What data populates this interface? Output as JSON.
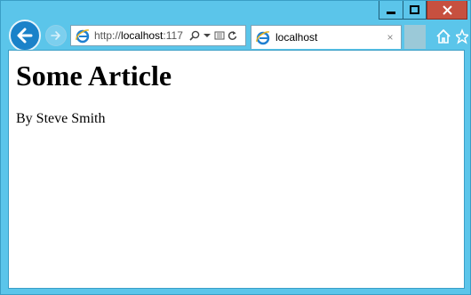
{
  "window": {
    "accent": "#5bc5ea",
    "close_color": "#c7503f"
  },
  "nav": {
    "back_icon": "back-arrow-icon",
    "forward_icon": "forward-arrow-icon",
    "address": {
      "prefix": "http://",
      "host": "localhost",
      "port_partial": ":117"
    },
    "tools": [
      "search-icon",
      "dropdown-arrow-icon",
      "compatibility-view-icon",
      "refresh-icon"
    ]
  },
  "tab": {
    "title": "localhost",
    "close_glyph": "×"
  },
  "toolbar": {
    "home_icon": "home-icon",
    "favorites_icon": "star-icon"
  },
  "page": {
    "heading": "Some Article",
    "byline": "By Steve Smith"
  }
}
